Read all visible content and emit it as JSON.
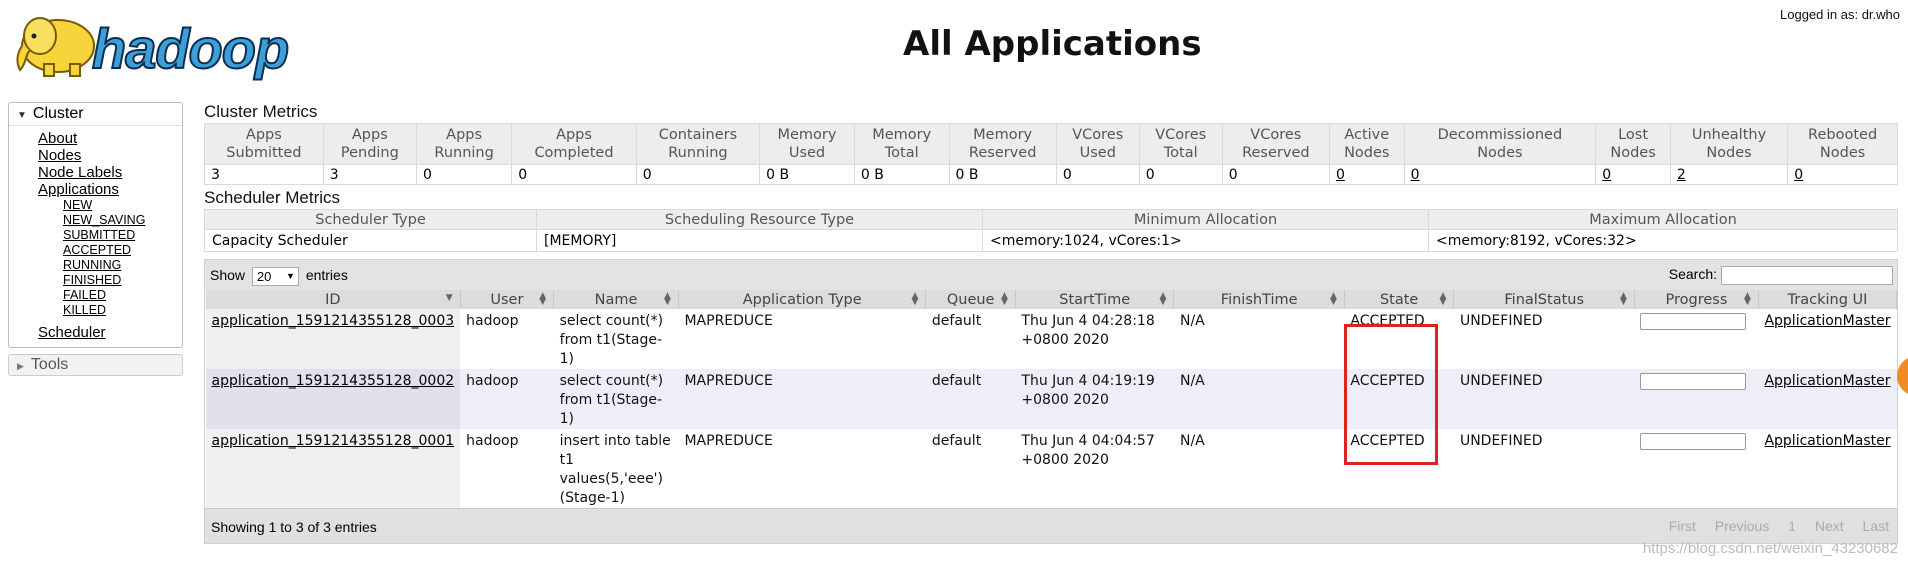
{
  "header": {
    "logo_text": "hadoop",
    "page_title": "All Applications",
    "logged_in": "Logged in as: dr.who"
  },
  "sidebar": {
    "cluster_label": "Cluster",
    "cluster_links": [
      "About",
      "Nodes",
      "Node Labels",
      "Applications"
    ],
    "app_states": [
      "NEW",
      "NEW_SAVING",
      "SUBMITTED",
      "ACCEPTED",
      "RUNNING",
      "FINISHED",
      "FAILED",
      "KILLED"
    ],
    "scheduler_label": "Scheduler",
    "tools_label": "Tools"
  },
  "cluster_metrics": {
    "title": "Cluster Metrics",
    "headers": [
      [
        "Apps",
        "Submitted"
      ],
      [
        "Apps",
        "Pending"
      ],
      [
        "Apps",
        "Running"
      ],
      [
        "Apps",
        "Completed"
      ],
      [
        "Containers",
        "Running"
      ],
      [
        "Memory",
        "Used"
      ],
      [
        "Memory",
        "Total"
      ],
      [
        "Memory",
        "Reserved"
      ],
      [
        "VCores",
        "Used"
      ],
      [
        "VCores",
        "Total"
      ],
      [
        "VCores",
        "Reserved"
      ],
      [
        "Active",
        "Nodes"
      ],
      [
        "Decommissioned",
        "Nodes"
      ],
      [
        "Lost",
        "Nodes"
      ],
      [
        "Unhealthy",
        "Nodes"
      ],
      [
        "Rebooted",
        "Nodes"
      ]
    ],
    "values": [
      "3",
      "3",
      "0",
      "0",
      "0",
      "0 B",
      "0 B",
      "0 B",
      "0",
      "0",
      "0",
      "0",
      "0",
      "0",
      "2",
      "0"
    ],
    "link_flags": [
      false,
      false,
      false,
      false,
      false,
      false,
      false,
      false,
      false,
      false,
      false,
      true,
      true,
      true,
      true,
      true
    ]
  },
  "scheduler_metrics": {
    "title": "Scheduler Metrics",
    "headers": [
      "Scheduler Type",
      "Scheduling Resource Type",
      "Minimum Allocation",
      "Maximum Allocation"
    ],
    "values": [
      "Capacity Scheduler",
      "[MEMORY]",
      "<memory:1024, vCores:1>",
      "<memory:8192, vCores:32>"
    ]
  },
  "apps_table": {
    "show_label": "Show",
    "page_size": "20",
    "entries_label": "entries",
    "search_label": "Search:",
    "search_value": "",
    "columns": [
      "ID",
      "User",
      "Name",
      "Application Type",
      "Queue",
      "StartTime",
      "FinishTime",
      "State",
      "FinalStatus",
      "Progress",
      "Tracking UI"
    ],
    "rows": [
      {
        "id": "application_1591214355128_0003",
        "user": "hadoop",
        "name": "select count(*) from t1(Stage-1)",
        "type": "MAPREDUCE",
        "queue": "default",
        "start": "Thu Jun 4 04:28:18 +0800 2020",
        "finish": "N/A",
        "state": "ACCEPTED",
        "final": "UNDEFINED",
        "progress": 0,
        "tracking": "ApplicationMaster"
      },
      {
        "id": "application_1591214355128_0002",
        "user": "hadoop",
        "name": "select count(*) from t1(Stage-1)",
        "type": "MAPREDUCE",
        "queue": "default",
        "start": "Thu Jun 4 04:19:19 +0800 2020",
        "finish": "N/A",
        "state": "ACCEPTED",
        "final": "UNDEFINED",
        "progress": 0,
        "tracking": "ApplicationMaster"
      },
      {
        "id": "application_1591214355128_0001",
        "user": "hadoop",
        "name": "insert into table t1 values(5,'eee')(Stage-1)",
        "type": "MAPREDUCE",
        "queue": "default",
        "start": "Thu Jun 4 04:04:57 +0800 2020",
        "finish": "N/A",
        "state": "ACCEPTED",
        "final": "UNDEFINED",
        "progress": 0,
        "tracking": "ApplicationMaster"
      }
    ],
    "footer_info": "Showing 1 to 3 of 3 entries",
    "pager": [
      "First",
      "Previous",
      "1",
      "Next",
      "Last"
    ]
  },
  "watermark": "https://blog.csdn.net/weixin_43230682",
  "colors": {
    "highlight": "#dd2222",
    "logo_blue": "#3d9fd8",
    "row_alt": "#eeeef8"
  }
}
